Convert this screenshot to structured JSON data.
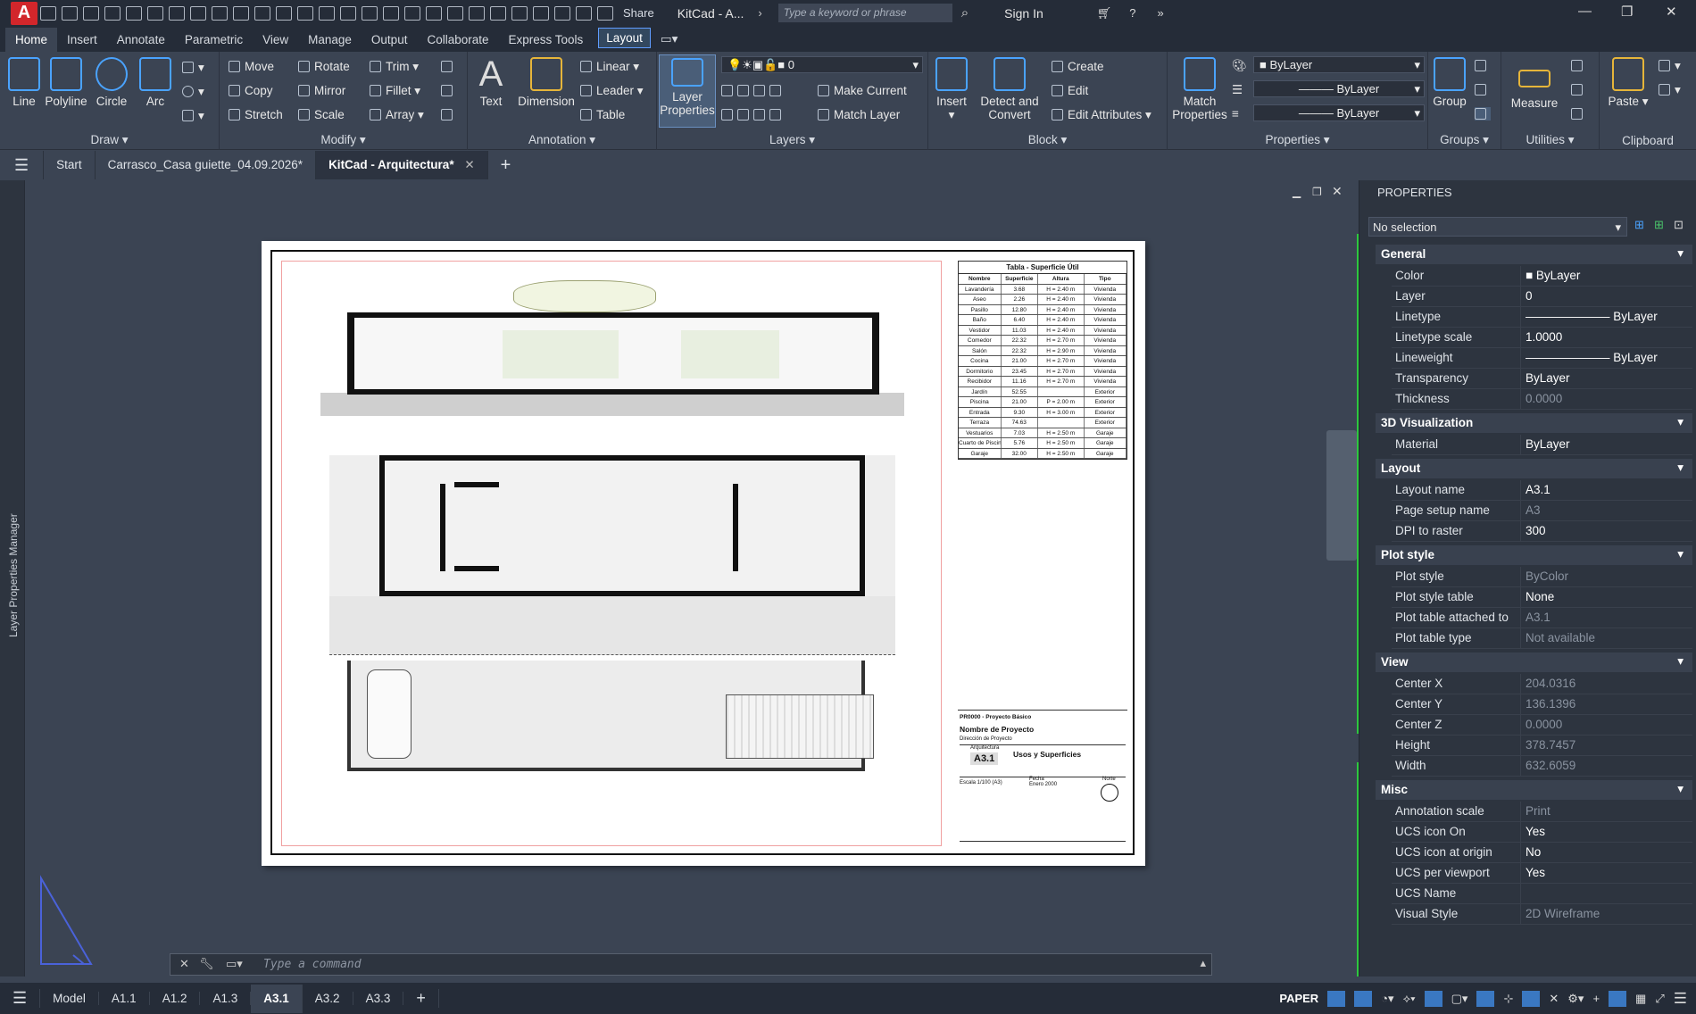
{
  "app": {
    "logo": "A",
    "title": "KitCad - A...",
    "share": "Share",
    "search_placeholder": "Type a keyword or phrase",
    "signin": "Sign In"
  },
  "ribbon_tabs": [
    "Home",
    "Insert",
    "Annotate",
    "Parametric",
    "View",
    "Manage",
    "Output",
    "Collaborate",
    "Express Tools",
    "Layout"
  ],
  "ribbon": {
    "draw": {
      "label": "Draw",
      "line": "Line",
      "polyline": "Polyline",
      "circle": "Circle",
      "arc": "Arc"
    },
    "modify": {
      "label": "Modify",
      "move": "Move",
      "rotate": "Rotate",
      "trim": "Trim",
      "copy": "Copy",
      "mirror": "Mirror",
      "fillet": "Fillet",
      "stretch": "Stretch",
      "scale": "Scale",
      "array": "Array"
    },
    "annotation": {
      "label": "Annotation",
      "text": "Text",
      "dimension": "Dimension",
      "linear": "Linear",
      "leader": "Leader",
      "table": "Table"
    },
    "layers": {
      "label": "Layers",
      "layer_properties_1": "Layer",
      "layer_properties_2": "Properties",
      "current_layer": "0",
      "make_current": "Make Current",
      "match_layer": "Match Layer"
    },
    "block": {
      "label": "Block",
      "insert": "Insert",
      "detect_1": "Detect and",
      "detect_2": "Convert",
      "create": "Create",
      "edit": "Edit",
      "edit_attributes": "Edit Attributes"
    },
    "properties": {
      "label": "Properties",
      "match_1": "Match",
      "match_2": "Properties",
      "color": "ByLayer",
      "linetype": "ByLayer",
      "lineweight": "ByLayer"
    },
    "groups": {
      "label": "Groups",
      "group": "Group"
    },
    "utilities": {
      "label": "Utilities",
      "measure": "Measure"
    },
    "clipboard": {
      "label": "Clipboard",
      "paste": "Paste"
    }
  },
  "doc_tabs": [
    "Start",
    "Carrasco_Casa guiette_04.09.2026*",
    "KitCad - Arquitectura*"
  ],
  "left_strip": "Layer Properties Manager",
  "sheet": {
    "table_title": "Tabla - Superficie Útil",
    "table_headers": [
      "Nombre",
      "Superficie",
      "Altura",
      "Tipo"
    ],
    "table_rows": [
      [
        "Lavandería",
        "3.68",
        "H = 2.40 m",
        "Vivienda"
      ],
      [
        "Aseo",
        "2.26",
        "H = 2.40 m",
        "Vivienda"
      ],
      [
        "Pasillo",
        "12.80",
        "H = 2.40 m",
        "Vivienda"
      ],
      [
        "Baño",
        "6.40",
        "H = 2.40 m",
        "Vivienda"
      ],
      [
        "Vestidor",
        "11.03",
        "H = 2.40 m",
        "Vivienda"
      ],
      [
        "Comedor",
        "22.32",
        "H = 2.70 m",
        "Vivienda"
      ],
      [
        "Salón",
        "22.32",
        "H = 2.90 m",
        "Vivienda"
      ],
      [
        "Cocina",
        "21.00",
        "H = 2.70 m",
        "Vivienda"
      ],
      [
        "Dormitorio",
        "23.45",
        "H = 2.70 m",
        "Vivienda"
      ],
      [
        "Recibidor",
        "11.16",
        "H = 2.70 m",
        "Vivienda"
      ],
      [
        "Jardín",
        "52.55",
        "",
        "Exterior"
      ],
      [
        "Piscina",
        "21.00",
        "P = 2.00 m",
        "Exterior"
      ],
      [
        "Entrada",
        "9.30",
        "H = 3.00 m",
        "Exterior"
      ],
      [
        "Terraza",
        "74.63",
        "",
        "Exterior"
      ],
      [
        "Vestuarios",
        "7.03",
        "H = 2.50 m",
        "Garaje"
      ],
      [
        "Cuarto de Piscinas",
        "5.76",
        "H = 2.50 m",
        "Garaje"
      ],
      [
        "Garaje",
        "32.00",
        "H = 2.50 m",
        "Garaje"
      ]
    ],
    "tb_project_code": "PR0000 - Proyecto Básico",
    "tb_project_name": "Nombre de Proyecto",
    "tb_project_sub": "Dirección de Proyecto",
    "tb_discipline": "Arquitectura",
    "tb_sheet": "A3.1",
    "tb_sheet_title": "Usos y Superficies",
    "tb_scale": "Escala 1/100 (A3)",
    "tb_date_label": "Fecha",
    "tb_date": "Enero 2000",
    "tb_north": "Norte"
  },
  "properties": {
    "title": "PROPERTIES",
    "selection": "No selection",
    "sections": [
      {
        "name": "General",
        "rows": [
          [
            "Color",
            "ByLayer"
          ],
          [
            "Layer",
            "0"
          ],
          [
            "Linetype",
            "ByLayer"
          ],
          [
            "Linetype scale",
            "1.0000"
          ],
          [
            "Lineweight",
            "ByLayer"
          ],
          [
            "Transparency",
            "ByLayer"
          ],
          [
            "Thickness",
            "0.0000"
          ]
        ]
      },
      {
        "name": "3D Visualization",
        "rows": [
          [
            "Material",
            "ByLayer"
          ]
        ]
      },
      {
        "name": "Layout",
        "rows": [
          [
            "Layout name",
            "A3.1"
          ],
          [
            "Page setup name",
            "A3"
          ],
          [
            "DPI to raster",
            "300"
          ]
        ]
      },
      {
        "name": "Plot style",
        "rows": [
          [
            "Plot style",
            "ByColor"
          ],
          [
            "Plot style table",
            "None"
          ],
          [
            "Plot table attached to",
            "A3.1"
          ],
          [
            "Plot table type",
            "Not available"
          ]
        ]
      },
      {
        "name": "View",
        "rows": [
          [
            "Center X",
            "204.0316"
          ],
          [
            "Center Y",
            "136.1396"
          ],
          [
            "Center Z",
            "0.0000"
          ],
          [
            "Height",
            "378.7457"
          ],
          [
            "Width",
            "632.6059"
          ]
        ]
      },
      {
        "name": "Misc",
        "rows": [
          [
            "Annotation scale",
            "Print"
          ],
          [
            "UCS icon On",
            "Yes"
          ],
          [
            "UCS icon at origin",
            "No"
          ],
          [
            "UCS per viewport",
            "Yes"
          ],
          [
            "UCS Name",
            ""
          ],
          [
            "Visual Style",
            "2D Wireframe"
          ]
        ]
      }
    ]
  },
  "command": {
    "placeholder": "Type a command"
  },
  "layout_tabs": [
    "Model",
    "A1.1",
    "A1.2",
    "A1.3",
    "A3.1",
    "A3.2",
    "A3.3"
  ],
  "status": {
    "space": "PAPER"
  }
}
